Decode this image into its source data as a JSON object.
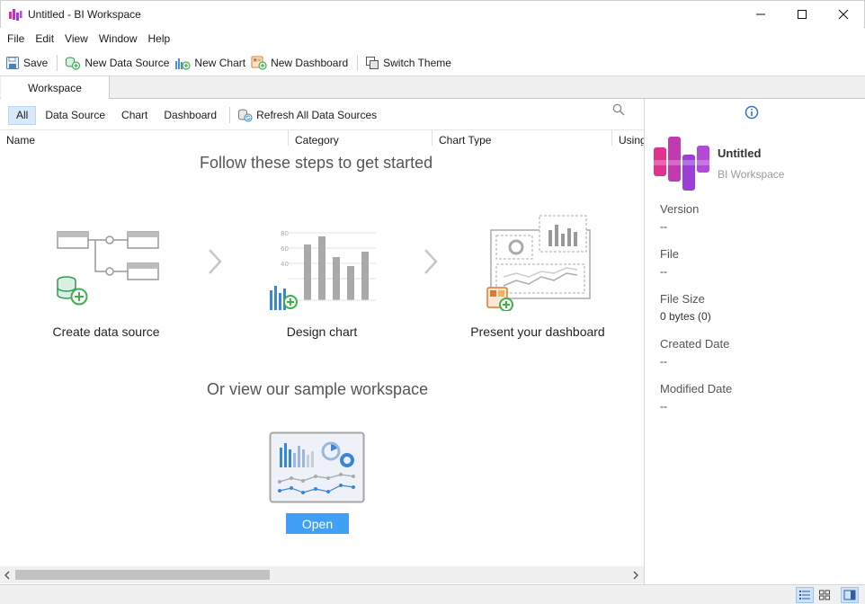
{
  "window": {
    "title": "Untitled - BI Workspace",
    "controls": [
      "minimize-icon",
      "maximize-icon",
      "close-icon"
    ]
  },
  "menu": {
    "items": [
      {
        "label": "File"
      },
      {
        "label": "Edit"
      },
      {
        "label": "View"
      },
      {
        "label": "Window"
      },
      {
        "label": "Help"
      }
    ]
  },
  "toolbar": {
    "save": "Save",
    "new_data_source": "New Data Source",
    "new_chart": "New Chart",
    "new_dashboard": "New Dashboard",
    "switch_theme": "Switch Theme"
  },
  "tabs": [
    {
      "label": "Workspace"
    }
  ],
  "filters": {
    "items": [
      {
        "label": "All",
        "active": true
      },
      {
        "label": "Data Source"
      },
      {
        "label": "Chart"
      },
      {
        "label": "Dashboard"
      }
    ],
    "refresh": "Refresh All Data Sources"
  },
  "columns": [
    "Name",
    "Category",
    "Chart Type",
    "Using"
  ],
  "getting_started": {
    "heading": "Follow these steps to get started",
    "steps": [
      {
        "label": "Create data source"
      },
      {
        "label": "Design chart"
      },
      {
        "label": "Present your dashboard"
      }
    ],
    "chart_axis_ticks": [
      "80",
      "60",
      "40"
    ],
    "sample_heading": "Or view our sample workspace",
    "open": "Open"
  },
  "info": {
    "name": "Untitled",
    "subtitle": "BI Workspace",
    "properties": [
      {
        "label": "Version",
        "value": "--"
      },
      {
        "label": "File",
        "value": "--"
      },
      {
        "label": "File Size",
        "value": "0 bytes (0)"
      },
      {
        "label": "Created Date",
        "value": "--"
      },
      {
        "label": "Modified Date",
        "value": "--"
      }
    ]
  },
  "colors": {
    "accent": "#42a0f4",
    "logo_pink": "#e0338f",
    "logo_purple": "#9b3fd6",
    "plus_green": "#3cb14a"
  }
}
